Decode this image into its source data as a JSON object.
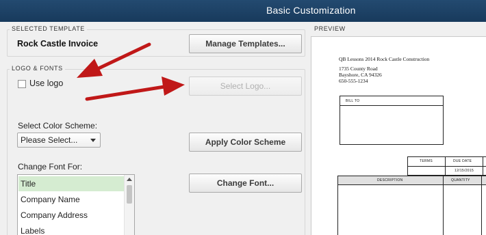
{
  "window": {
    "title": "Basic Customization"
  },
  "selected_template": {
    "legend": "SELECTED TEMPLATE",
    "name": "Rock Castle Invoice",
    "manage_button": "Manage Templates..."
  },
  "logo_fonts": {
    "legend": "LOGO & FONTS",
    "use_logo_label": "Use logo",
    "use_logo_checked": false,
    "select_logo_button": "Select Logo...",
    "color_scheme_label": "Select Color Scheme:",
    "color_scheme_value": "Please Select...",
    "apply_color_button": "Apply Color Scheme",
    "change_font_label": "Change Font For:",
    "font_items": [
      "Title",
      "Company Name",
      "Company Address",
      "Labels"
    ],
    "selected_font_item": "Title",
    "change_font_button": "Change Font..."
  },
  "preview": {
    "legend": "PREVIEW",
    "company_lines": [
      "QB Lessons 2014 Rock Castle Construction",
      "1735 County Road",
      "Bayshore, CA 94326",
      "650-555-1234"
    ],
    "bill_to": "BILL TO",
    "terms": "TERMS",
    "due_date": "DUE DATE",
    "due_date_value": "12/15/2015",
    "description": "DESCRIPTION",
    "quantity": "QUANTITY"
  },
  "colors": {
    "titlebar": "#1f4367",
    "selected_list_item": "#d5ecd1",
    "annotation_arrow": "#c01818"
  }
}
